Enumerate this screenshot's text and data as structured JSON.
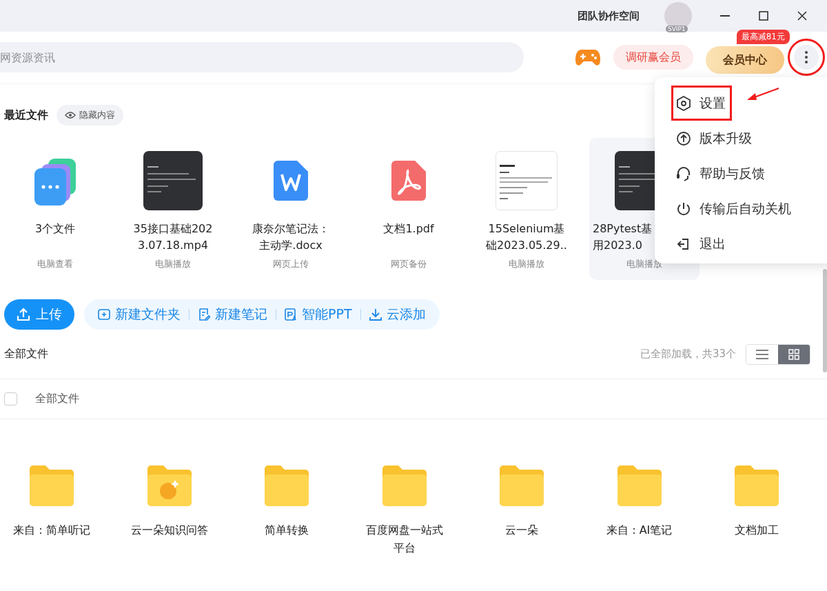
{
  "title_bar": {
    "team_space": "团队协作空间",
    "avatar_badge": "SVIP1"
  },
  "toolbar": {
    "search": {
      "placeholder": "网资源资讯"
    },
    "survey_button": "调研赢会员",
    "vip_button": {
      "label": "会员中心",
      "badge": "最高减81元"
    },
    "more_button": {
      "highlighted": true
    }
  },
  "recent": {
    "title": "最近文件",
    "hide_button": "隐藏内容",
    "items": [
      {
        "kind": "stack",
        "name": [
          "3个文件"
        ],
        "source": "电脑查看",
        "selected": false
      },
      {
        "kind": "video",
        "name": [
          "35接口基础202",
          "3.07.18.mp4"
        ],
        "source": "电脑播放",
        "selected": false
      },
      {
        "kind": "word",
        "name": [
          "康奈尔笔记法：",
          "主动学.docx"
        ],
        "source": "网页上传",
        "selected": false
      },
      {
        "kind": "pdf",
        "name": [
          "文档1.pdf"
        ],
        "source": "网页备份",
        "selected": false
      },
      {
        "kind": "doc",
        "name": [
          "15Selenium基",
          "础2023.05.29.."
        ],
        "source": "电脑播放",
        "selected": false
      },
      {
        "kind": "video",
        "name": [
          "28Pytest基",
          "用2023.0"
        ],
        "source": "电脑播放",
        "selected": true,
        "cut": true
      }
    ]
  },
  "actions": {
    "upload": "上传",
    "tools": [
      {
        "kind": "folder",
        "label": "新建文件夹"
      },
      {
        "kind": "note",
        "label": "新建笔记"
      },
      {
        "kind": "ppt",
        "label": "智能PPT"
      },
      {
        "kind": "download",
        "label": "云添加"
      }
    ]
  },
  "files": {
    "title": "全部文件",
    "status": "已全部加载，共33个",
    "views": [
      {
        "kind": "list",
        "selected": false
      },
      {
        "kind": "grid",
        "selected": true
      }
    ],
    "header": {
      "label": "全部文件",
      "checked": false
    },
    "folders": [
      {
        "kind": "folder",
        "name": "来自：简单听记"
      },
      {
        "kind": "app",
        "name": "云一朵知识问答"
      },
      {
        "kind": "folder",
        "name": "简单转换"
      },
      {
        "kind": "folder",
        "name": "百度网盘一站式平台"
      },
      {
        "kind": "folder",
        "name": "云一朵"
      },
      {
        "kind": "folder",
        "name": "来自：AI笔记"
      },
      {
        "kind": "folder",
        "name": "文档加工"
      }
    ]
  },
  "menu": {
    "items": [
      {
        "kind": "settings",
        "label": "设置",
        "highlighted": true
      },
      {
        "kind": "upgrade",
        "label": "版本升级",
        "highlighted": false
      },
      {
        "kind": "help",
        "label": "帮助与反馈",
        "highlighted": false
      },
      {
        "kind": "power",
        "label": "传输后自动关机",
        "highlighted": false
      },
      {
        "kind": "exit",
        "label": "退出",
        "highlighted": false
      }
    ]
  }
}
